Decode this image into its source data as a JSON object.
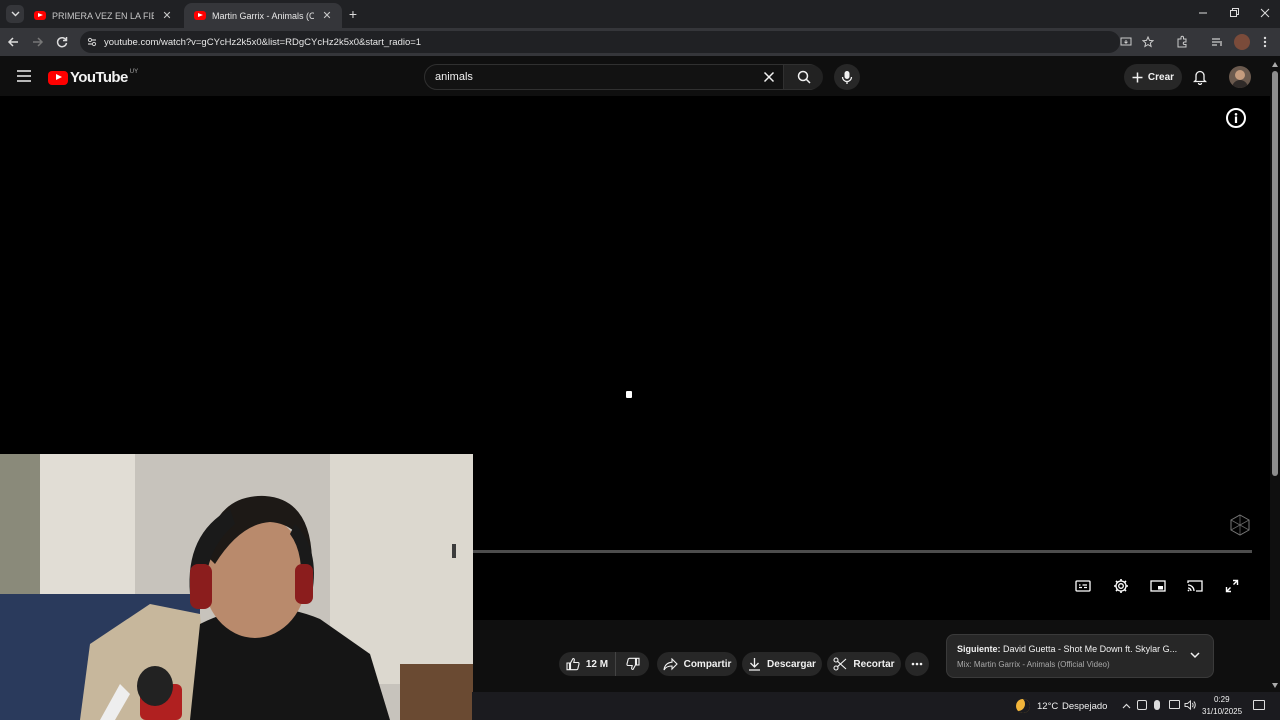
{
  "browser": {
    "tabs": [
      {
        "title": "PRIMERA VEZ EN LA FIESTA DE",
        "active": false
      },
      {
        "title": "Martin Garrix - Animals (Official",
        "active": true
      }
    ],
    "url": "youtube.com/watch?v=gCYcHz2k5x0&list=RDgCYcHz2k5x0&start_radio=1"
  },
  "youtube": {
    "logo_text": "YouTube",
    "region": "UY",
    "search_value": "animals",
    "create_label": "Crear"
  },
  "actions": {
    "likes": "12 M",
    "share": "Compartir",
    "download": "Descargar",
    "clip": "Recortar"
  },
  "up_next": {
    "label": "Siguiente:",
    "title": "David Guetta - Shot Me Down ft. Skylar G...",
    "mix": "Mix: Martin Garrix - Animals (Official Video)"
  },
  "taskbar": {
    "weather": "12°C",
    "condition": "Despejado",
    "time": "0:29",
    "date": "31/10/2025"
  },
  "colors": {
    "youtube_red": "#ff0000",
    "background": "#0f0f0f",
    "chip": "#272727"
  }
}
